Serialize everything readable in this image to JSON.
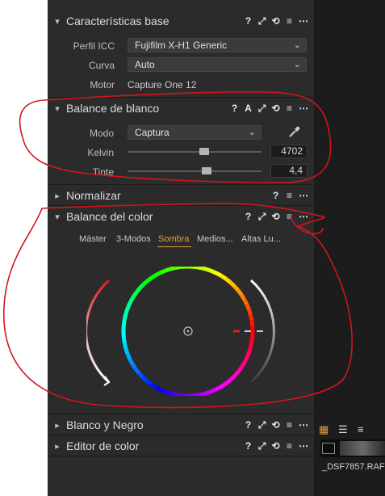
{
  "sections": {
    "base": {
      "title": "Características base",
      "chevron": "▾",
      "fields": {
        "icc_label": "Perfil ICC",
        "icc_value": "Fujifilm X-H1 Generic",
        "curve_label": "Curva",
        "curve_value": "Auto",
        "engine_label": "Motor",
        "engine_value": "Capture One 12"
      }
    },
    "white_balance": {
      "title": "Balance de blanco",
      "chevron": "▾",
      "tool_auto": "A",
      "mode_label": "Modo",
      "mode_value": "Captura",
      "kelvin_label": "Kelvin",
      "kelvin_value": "4702",
      "kelvin_level": 0.58,
      "tint_label": "Tinte",
      "tint_value": "4,4",
      "tint_level": 0.6
    },
    "normalize": {
      "title": "Normalizar",
      "chevron": "▸"
    },
    "color_balance": {
      "title": "Balance del color",
      "chevron": "▾",
      "tabs": [
        "Máster",
        "3-Modos",
        "Sombra",
        "Medios...",
        "Altas Lu..."
      ],
      "active_tab": "Sombra"
    },
    "bw": {
      "title": "Blanco y Negro",
      "chevron": "▸"
    },
    "color_editor": {
      "title": "Editor de color",
      "chevron": "▸"
    }
  },
  "tools": {
    "help": "?",
    "reset": "⟲",
    "menu": "≡",
    "more": "⋯"
  },
  "sidebar": {
    "thumb_name": "_DSF7857.RAF"
  },
  "colors": {
    "accent": "#e89a3c",
    "annotation": "#d0161b",
    "panel": "#2b2b2b"
  }
}
